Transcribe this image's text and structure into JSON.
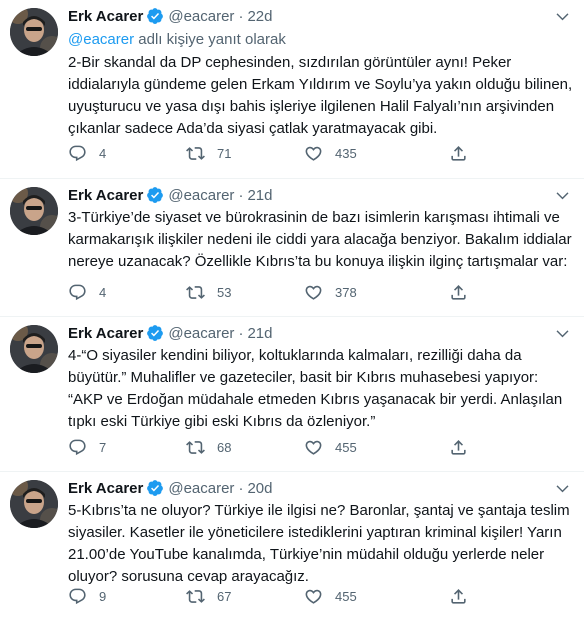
{
  "tweets": [
    {
      "author_name": "Erk Acarer",
      "handle": "@eacarer",
      "time": "22d",
      "reply_prefix": "@eacarer",
      "reply_suffix": " adlı kişiye yanıt olarak",
      "text": "2-Bir skandal da DP cephesinden, sızdırılan görüntüler aynı! Peker iddialarıyla gündeme gelen Erkam Yıldırım ve Soylu’ya yakın olduğu bilinen, uyuşturucu ve yasa dışı bahis işleriye ilgilenen Halil Falyalı’nın arşivinden çıkanlar sadece Ada’da siyasi çatlak yaratmayacak gibi.",
      "replies": "4",
      "retweets": "71",
      "likes": "435"
    },
    {
      "author_name": "Erk Acarer",
      "handle": "@eacarer",
      "time": "21d",
      "text": "3-Türkiye’de siyaset ve bürokrasinin de bazı isimlerin karışması ihtimali ve karmakarışık ilişkiler nedeni ile ciddi yara alacağa benziyor. Bakalım iddialar nereye uzanacak? Özellikle Kıbrıs’ta bu konuya ilişkin ilginç tartışmalar var:",
      "replies": "4",
      "retweets": "53",
      "likes": "378"
    },
    {
      "author_name": "Erk Acarer",
      "handle": "@eacarer",
      "time": "21d",
      "text": "4-“O siyasiler kendini biliyor, koltuklarında kalmaları, rezilliği daha da büyütür.” Muhalifler ve gazeteciler, basit bir Kıbrıs muhasebesi yapıyor: “AKP ve Erdoğan müdahale etmeden Kıbrıs yaşanacak bir yerdi. Anlaşılan tıpkı eski Türkiye gibi eski Kıbrıs da özleniyor.”",
      "replies": "7",
      "retweets": "68",
      "likes": "455"
    },
    {
      "author_name": "Erk Acarer",
      "handle": "@eacarer",
      "time": "20d",
      "text": "5-Kıbrıs’ta ne oluyor? Türkiye ile ilgisi ne? Baronlar, şantaj ve şantaja teslim siyasiler. Kasetler ile yöneticilere istediklerini yaptıran kriminal kişiler! Yarın 21.00’de YouTube kanalımda, Türkiye’nin müdahil olduğu yerlerde neler oluyor? sorusuna cevap arayacağız.",
      "replies": "9",
      "retweets": "67",
      "likes": "455"
    }
  ],
  "icons": {
    "verified": "verified-badge-icon",
    "more": "more-options-icon",
    "reply": "reply-icon",
    "retweet": "retweet-icon",
    "like": "heart-icon",
    "share": "share-icon"
  },
  "colors": {
    "accent": "#1d9bf0",
    "text": "#0f1419",
    "secondary": "#536471"
  }
}
